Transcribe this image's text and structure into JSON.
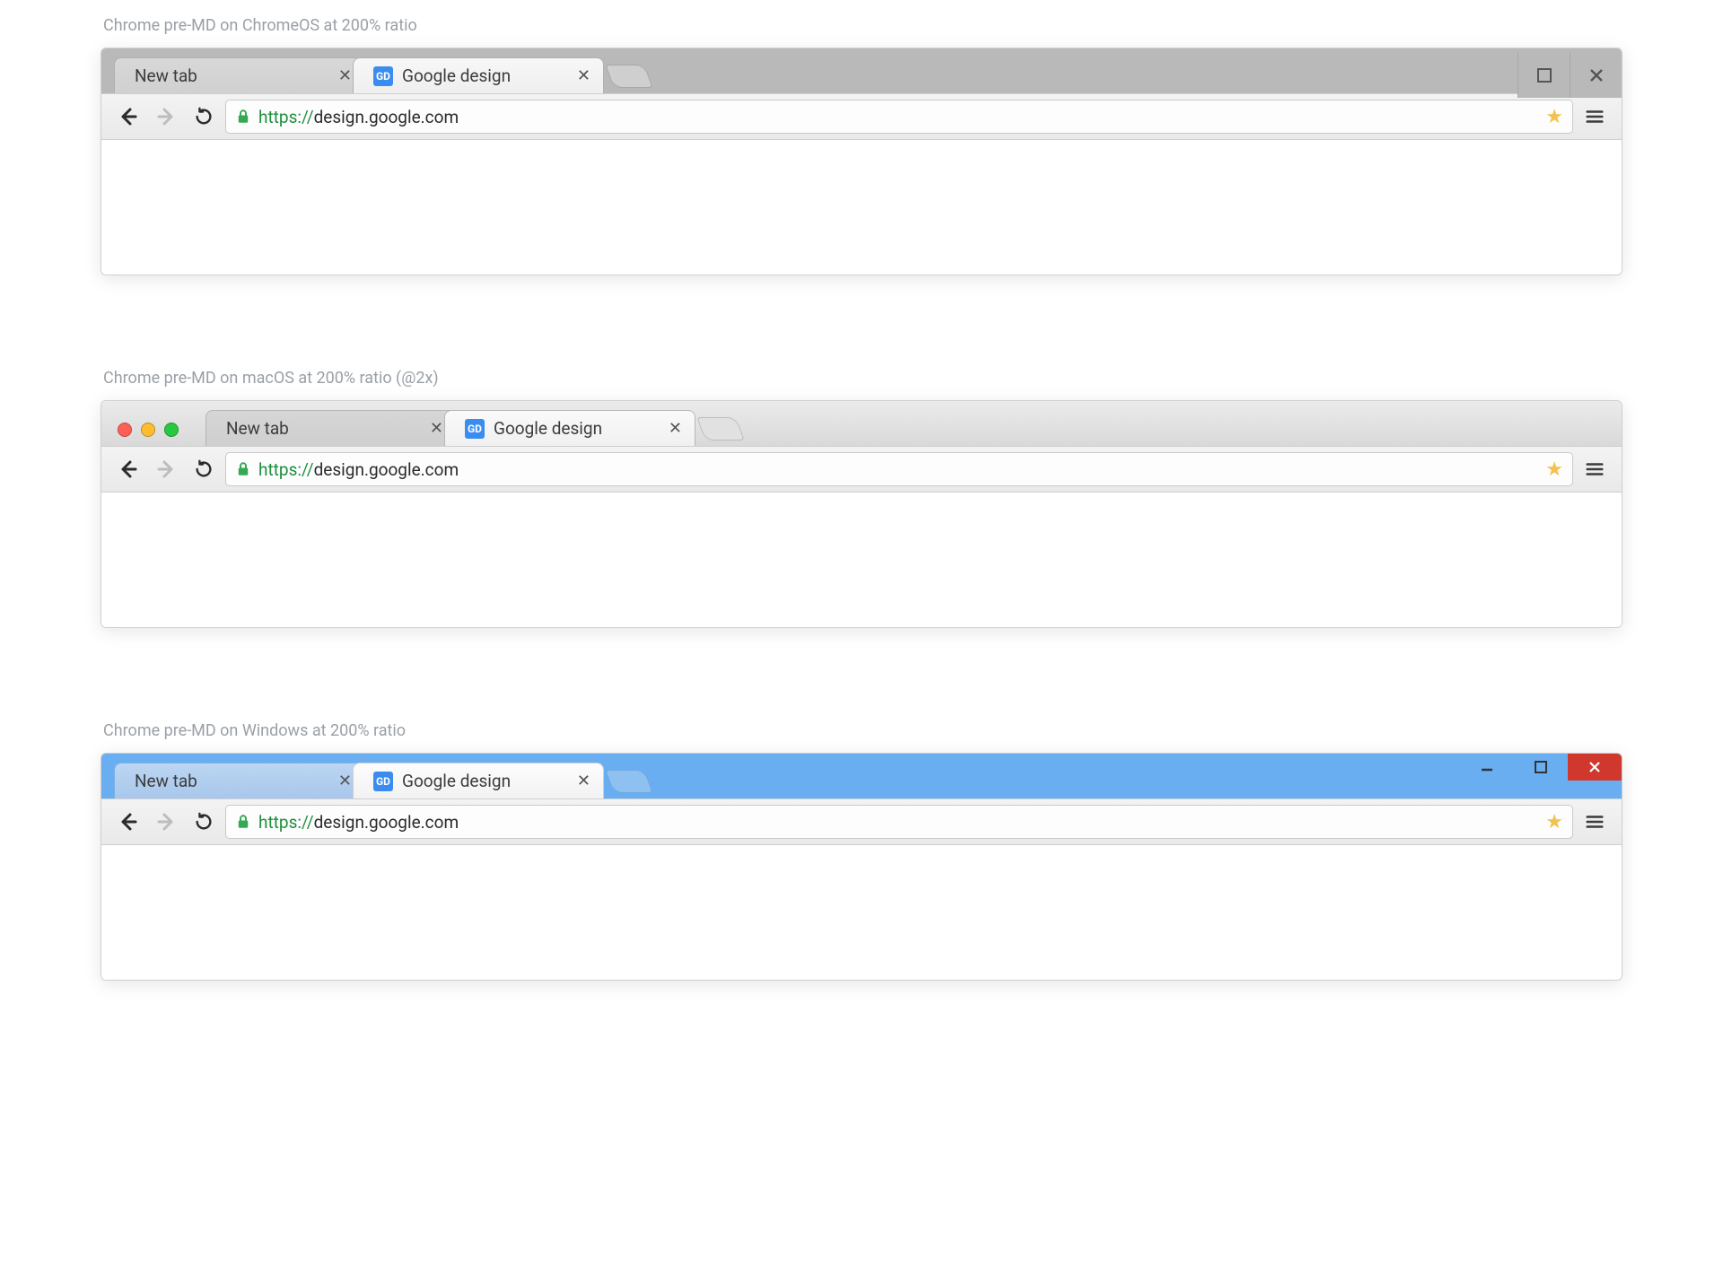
{
  "captions": {
    "chromeos": "Chrome pre-MD on ChromeOS at 200% ratio",
    "macos": "Chrome pre-MD on macOS at 200% ratio (@2x)",
    "windows": "Chrome pre-MD on Windows at 200% ratio"
  },
  "tabs": {
    "inactive_title": "New tab",
    "active_title": "Google design",
    "favicon_label": "GD"
  },
  "omnibox": {
    "scheme": "https://",
    "rest": "design.google.com"
  }
}
